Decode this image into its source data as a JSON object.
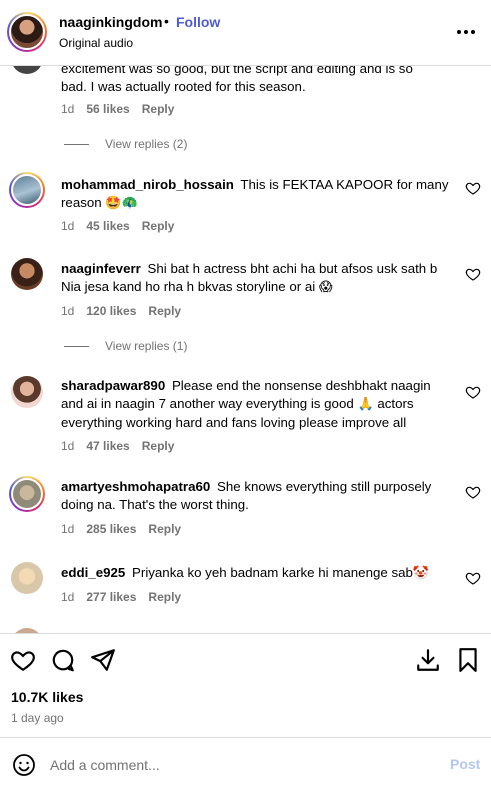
{
  "header": {
    "username": "naaginkingdom",
    "separator": "•",
    "follow_label": "Follow",
    "audio": "Original audio"
  },
  "comments": [
    {
      "text_partial": "excitement was so good, but the script and editing and is so",
      "text": "bad. I was actually rooted for this season.",
      "time": "1d",
      "likes": "56 likes",
      "reply": "Reply"
    },
    {
      "view_replies": "View replies (2)"
    },
    {
      "username": "mohammad_nirob_hossain",
      "text": "This is FEKTAA KAPOOR for many reason",
      "emoji": "🤩🦚",
      "time": "1d",
      "likes": "45 likes",
      "reply": "Reply"
    },
    {
      "username": "naaginfeverr",
      "text": "Shi bat h actress bht achi ha but afsos usk sath b Nia jesa kand ho rha h bkvas storyline or ai",
      "emoji": "😱",
      "time": "1d",
      "likes": "120 likes",
      "reply": "Reply"
    },
    {
      "view_replies": "View replies (1)"
    },
    {
      "username": "sharadpawar890",
      "text": "Please end the nonsense deshbhakt naagin and ai in naagin 7 another way everything is good",
      "emoji": "🙏",
      "text2": "actors everything working hard and fans loving please improve all",
      "time": "1d",
      "likes": "47 likes",
      "reply": "Reply"
    },
    {
      "username": "amartyeshmohapatra60",
      "text": "She knows everything still purposely doing na. That's the worst thing.",
      "time": "1d",
      "likes": "285 likes",
      "reply": "Reply"
    },
    {
      "username": "eddi_e925",
      "text": "Priyanka ko yeh badnam karke hi manenge sab",
      "emoji": "🤡",
      "time": "1d",
      "likes": "277 likes",
      "reply": "Reply"
    }
  ],
  "icons": {
    "more": "more-options-icon",
    "heart": "heart-icon",
    "comment": "comment-icon",
    "share": "share-icon",
    "save": "bookmark-icon",
    "download": "download-icon",
    "emoji": "emoji-icon"
  },
  "footer": {
    "likes": "10.7K likes",
    "time": "1 day ago",
    "add_comment_placeholder": "Add a comment...",
    "post_label": "Post"
  },
  "colors": {
    "follow": "#4f5bd5",
    "muted": "#737373",
    "post_disabled": "#b3c8f0",
    "border": "#dbdbdb"
  }
}
